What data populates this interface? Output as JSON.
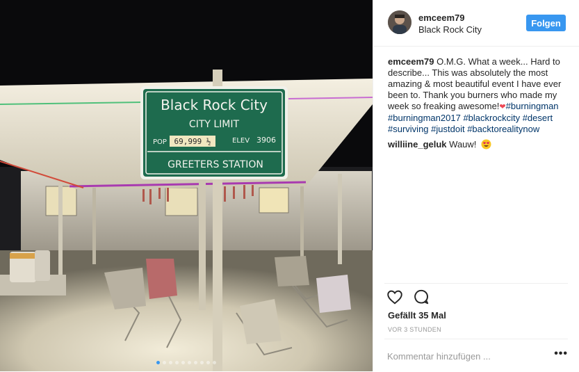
{
  "post": {
    "photo_alt": "Black Rock City sign at night",
    "sign": {
      "title": "Black Rock City",
      "subtitle": "CITY LIMIT",
      "pop_label": "POP",
      "pop_value": "69,999 ½",
      "elev_label": "ELEV",
      "elev_value": "3906",
      "footer": "GREETERS STATION"
    },
    "carousel": {
      "total": 10,
      "active": 0
    }
  },
  "header": {
    "username": "emceem79",
    "location": "Black Rock City",
    "follow_label": "Folgen"
  },
  "caption": {
    "username": "emceem79",
    "text": "O.M.G. What a week... Hard to describe... This was absolutely the most amazing & most beautiful event I have ever been to. Thank you burners who made my week so freaking awesome!",
    "heart": "❤",
    "hashtags": [
      "#burningman",
      "#burningman2017",
      "#blackrockcity",
      "#desert",
      "#surviving",
      "#justdoit",
      "#backtorealitynow"
    ]
  },
  "comment": {
    "username": "williine_geluk",
    "text": "Wauw!",
    "emoji": "heart-eyes-emoji"
  },
  "likes": "Gefällt 35 Mal",
  "timestamp": "VOR 3 STUNDEN",
  "add_comment": {
    "placeholder": "Kommentar hinzufügen ..."
  },
  "more_label": "•••",
  "icons": {
    "like": "heart-outline-icon",
    "comment": "speech-bubble-icon",
    "more": "more-options-icon"
  },
  "colors": {
    "accent": "#3897f0",
    "hashtag": "#003569",
    "sign_green": "#1e6b4e"
  }
}
